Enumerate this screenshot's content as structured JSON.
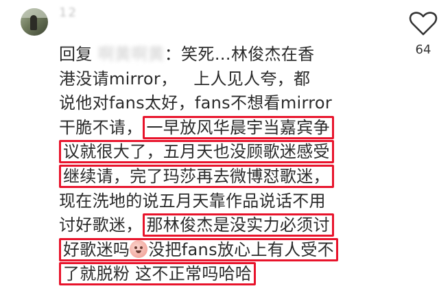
{
  "comment": {
    "username": "12",
    "reply_prefix": "回复",
    "reply_target": "啊黄啊黄",
    "lines": [
      {
        "segments": [
          {
            "text": "",
            "type": "blank"
          },
          {
            "text": "：笑死…林俊杰在香",
            "type": "plain"
          }
        ]
      },
      {
        "segments": [
          {
            "text": "港没请mirror，",
            "type": "plain"
          },
          {
            "text": "",
            "type": "mask"
          },
          {
            "text": "上人见人夸，都",
            "type": "plain"
          }
        ]
      },
      {
        "segments": [
          {
            "text": "说他对fans太好，fans不想看mirror",
            "type": "plain"
          }
        ]
      },
      {
        "segments": [
          {
            "text": "干脆不请，",
            "type": "plain"
          },
          {
            "text": "一早放风华晨宇当嘉宾争",
            "type": "highlight"
          }
        ]
      },
      {
        "segments": [
          {
            "text": "议就很大了，五月天也没顾歌迷感受",
            "type": "highlight"
          }
        ]
      },
      {
        "segments": [
          {
            "text": "继续请，完了玛莎再去微博怼歌迷，",
            "type": "highlight"
          }
        ]
      },
      {
        "segments": [
          {
            "text": "现在洗地的说五月天靠作品说话不用",
            "type": "plain"
          }
        ]
      },
      {
        "segments": [
          {
            "text": "讨好歌迷，",
            "type": "plain"
          },
          {
            "text": "那林俊杰是没实力必须讨",
            "type": "highlight"
          }
        ]
      },
      {
        "segments": [
          {
            "text": "好歌迷吗",
            "type": "highlight"
          },
          {
            "text": "",
            "type": "emoji"
          },
          {
            "text": "没把fans放心上有人受不",
            "type": "highlight"
          }
        ]
      },
      {
        "segments": [
          {
            "text": "了就脱粉 这不正常吗哈哈",
            "type": "highlight"
          }
        ]
      }
    ],
    "like_count": "64",
    "emoji_icon": "peach-face-emoji",
    "highlight_color": "#e8132b"
  }
}
